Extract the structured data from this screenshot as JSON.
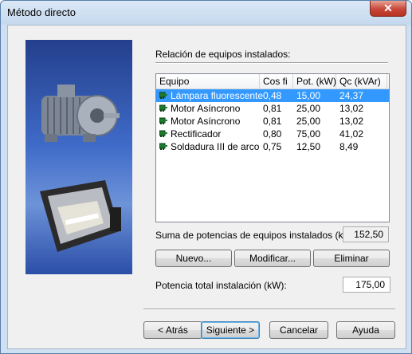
{
  "window": {
    "title": "Método directo",
    "close_label": "✕"
  },
  "list_section": {
    "label": "Relación de equipos instalados:"
  },
  "table": {
    "columns": [
      "Equipo",
      "Cos fi",
      "Pot. (kW)",
      "Qc (kVAr)"
    ],
    "rows": [
      {
        "equipo": "Lámpara fluorescente",
        "cosfi": "0,48",
        "pot": "15,00",
        "qc": "24,37"
      },
      {
        "equipo": "Motor Asíncrono",
        "cosfi": "0,81",
        "pot": "25,00",
        "qc": "13,02"
      },
      {
        "equipo": "Motor Asíncrono",
        "cosfi": "0,81",
        "pot": "25,00",
        "qc": "13,02"
      },
      {
        "equipo": "Rectificador",
        "cosfi": "0,80",
        "pot": "75,00",
        "qc": "41,02"
      },
      {
        "equipo": "Soldadura III de arco",
        "cosfi": "0,75",
        "pot": "12,50",
        "qc": "8,49"
      }
    ],
    "selected_row": 0,
    "row_icon": "equipment-icon"
  },
  "sum": {
    "label": "Suma de potencias de equipos instalados (kW):",
    "value": "152,50"
  },
  "actions": {
    "new": "Nuevo...",
    "modify": "Modificar...",
    "delete": "Eliminar"
  },
  "total": {
    "label": "Potencia total instalación (kW):",
    "value": "175,00"
  },
  "footer": {
    "back": "< Atrás",
    "next": "Siguiente >",
    "cancel": "Cancelar",
    "help": "Ayuda"
  },
  "colors": {
    "selection": "#3399ff",
    "titlebar": "#c4d8ee",
    "close": "#c8473a"
  }
}
